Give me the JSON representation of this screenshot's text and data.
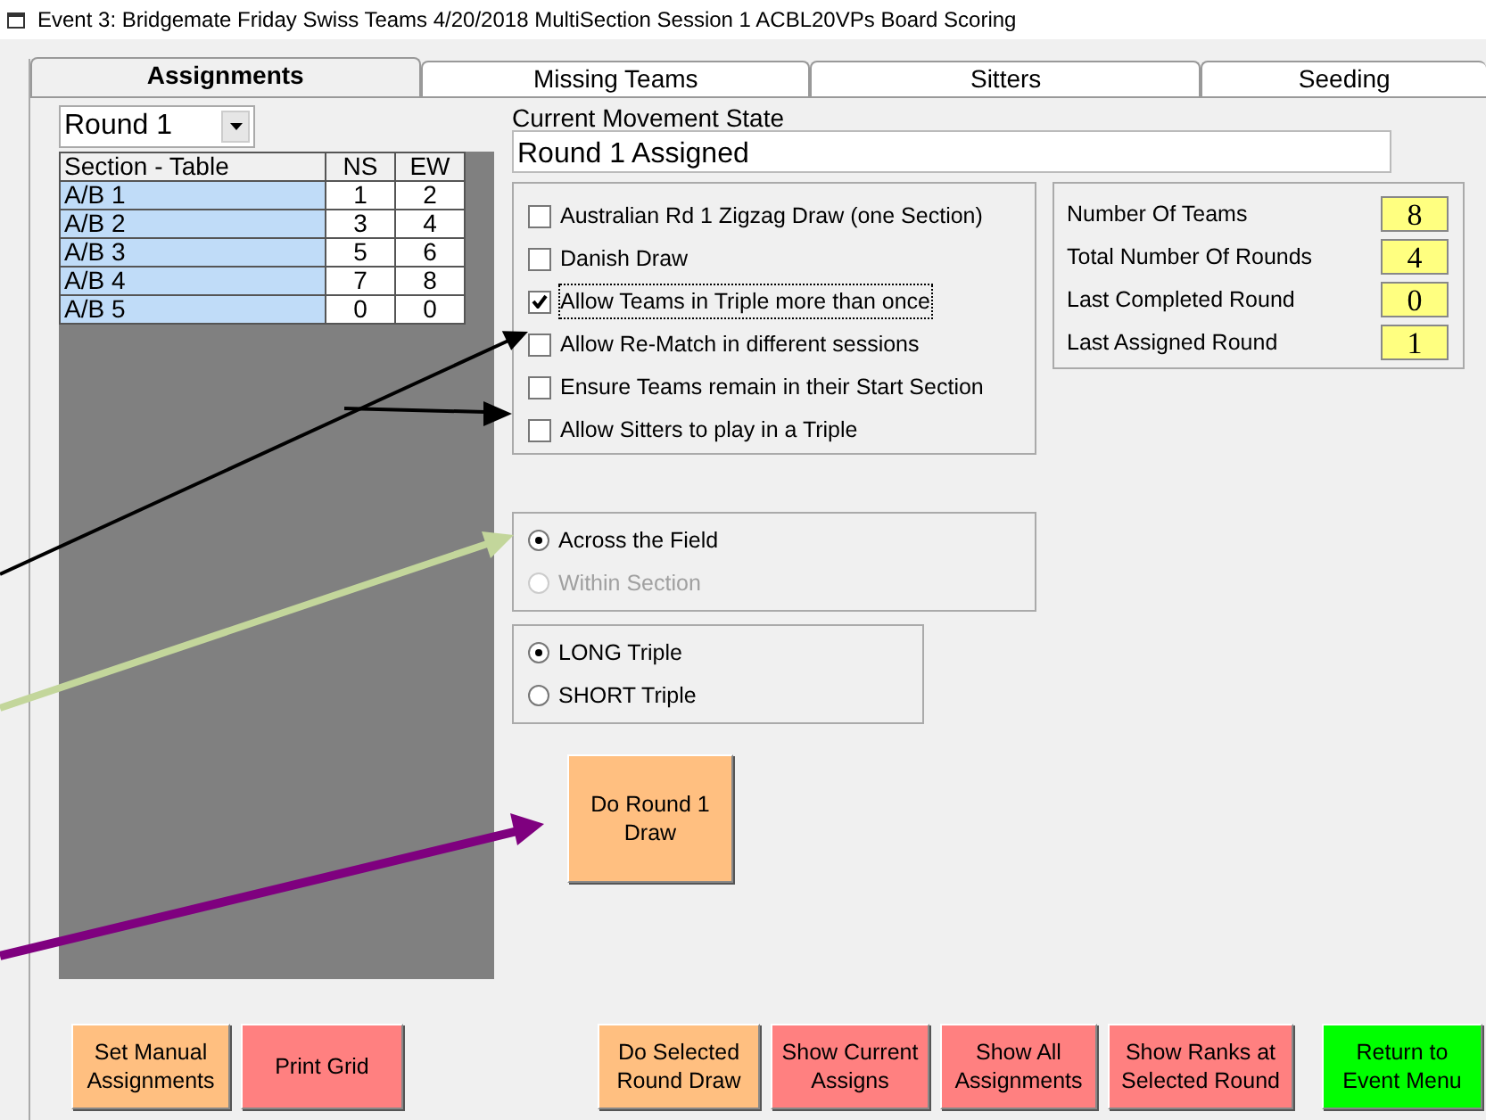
{
  "window": {
    "title": "Event 3: Bridgemate Friday Swiss Teams 4/20/2018 MultiSection Session 1 ACBL20VPs Board Scoring"
  },
  "tabs": [
    {
      "label": "Assignments",
      "selected": true
    },
    {
      "label": "Missing Teams",
      "selected": false
    },
    {
      "label": "Sitters",
      "selected": false
    },
    {
      "label": "Seeding",
      "selected": false
    }
  ],
  "round_select": {
    "value": "Round 1"
  },
  "table": {
    "columns": [
      "Section - Table",
      "NS",
      "EW"
    ],
    "rows": [
      [
        "A/B 1",
        "1",
        "2"
      ],
      [
        "A/B 2",
        "3",
        "4"
      ],
      [
        "A/B 3",
        "5",
        "6"
      ],
      [
        "A/B 4",
        "7",
        "8"
      ],
      [
        "A/B 5",
        "0",
        "0"
      ]
    ]
  },
  "movement_state": {
    "label": "Current Movement State",
    "value": "Round 1 Assigned"
  },
  "options": [
    {
      "label": "Australian Rd 1 Zigzag Draw (one Section)",
      "checked": false,
      "focused": false
    },
    {
      "label": "Danish Draw",
      "checked": false,
      "focused": false
    },
    {
      "label": "Allow Teams in Triple more than once",
      "checked": true,
      "focused": true
    },
    {
      "label": "Allow Re-Match in different sessions",
      "checked": false,
      "focused": false
    },
    {
      "label": "Ensure Teams remain in their Start Section",
      "checked": false,
      "focused": false
    },
    {
      "label": "Allow Sitters to play in a Triple",
      "checked": false,
      "focused": false
    }
  ],
  "stats": [
    {
      "label": "Number Of Teams",
      "value": "8"
    },
    {
      "label": "Total Number Of Rounds",
      "value": "4"
    },
    {
      "label": "Last Completed Round",
      "value": "0"
    },
    {
      "label": "Last Assigned Round",
      "value": "1"
    }
  ],
  "field_mode": [
    {
      "label": "Across the Field",
      "selected": true,
      "disabled": false
    },
    {
      "label": "Within Section",
      "selected": false,
      "disabled": true
    }
  ],
  "triple_type": [
    {
      "label": "LONG Triple",
      "selected": true,
      "disabled": false
    },
    {
      "label": "SHORT Triple",
      "selected": false,
      "disabled": false
    }
  ],
  "draw_button": {
    "label": "Do Round 1\nDraw",
    "color": "#ffbf80"
  },
  "button_groups": [
    {
      "buttons": [
        {
          "label": "Set Manual\nAssignments",
          "color": "#ffbf80"
        },
        {
          "label": "Print Grid",
          "color": "#ff8080"
        }
      ]
    },
    {
      "buttons": [
        {
          "label": "Do Selected\nRound Draw",
          "color": "#ffbf80"
        },
        {
          "label": "Show Current\nAssigns",
          "color": "#ff8080"
        },
        {
          "label": "Show All\nAssignments",
          "color": "#ff8080"
        },
        {
          "label": "Show Ranks at\nSelected Round",
          "color": "#ff8080"
        }
      ]
    },
    {
      "buttons": [
        {
          "label": "Return to\nEvent Menu",
          "color": "#00ff00"
        }
      ]
    }
  ]
}
